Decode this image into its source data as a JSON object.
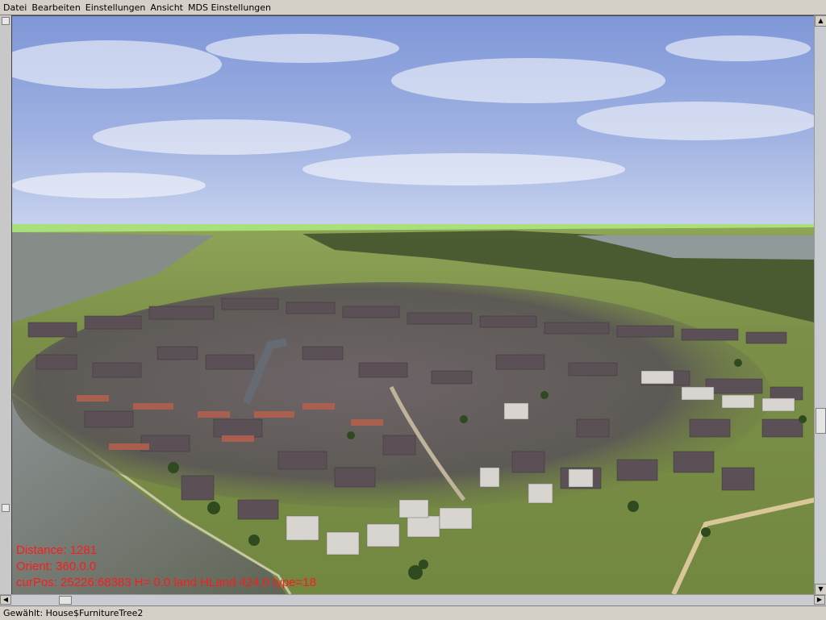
{
  "menubar": {
    "items": [
      "Datei",
      "Bearbeiten",
      "Einstellungen",
      "Ansicht",
      "MDS Einstellungen"
    ]
  },
  "viewport": {
    "overlay": {
      "distance": "Distance: 1281",
      "orient": "Orient: 360.0.0",
      "curpos": "curPos: 25226:68383 H= 0.0 land HLand 424.0 type=18"
    },
    "overlay_color": "#ff1a1a"
  },
  "statusbar": {
    "text": "Gewählt: House$FurnitureTree2"
  },
  "colors": {
    "sky_top": "#7f97d8",
    "sky_horizon": "#c7d2ee",
    "grass": "#7a8f45",
    "water": "#6d7463"
  }
}
